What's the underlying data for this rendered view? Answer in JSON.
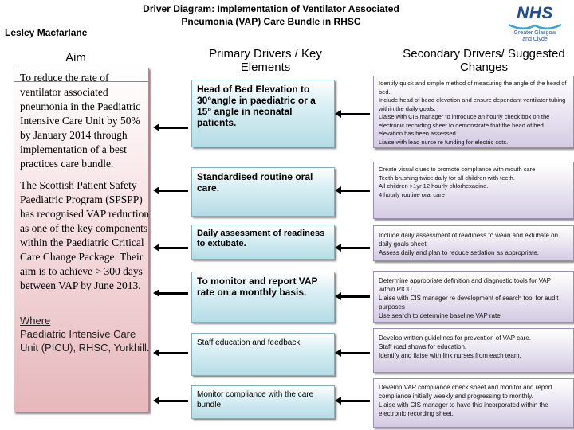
{
  "header": {
    "title_line1": "Driver Diagram: Implementation of Ventilator Associated",
    "title_line2": "Pneumonia (VAP) Care Bundle in RHSC",
    "author": "Lesley Macfarlane"
  },
  "logo": {
    "name": "NHS",
    "sub_line1": "Greater Glasgow",
    "sub_line2": "and Clyde",
    "brand_color": "#1f4e96"
  },
  "columns": {
    "aim": "Aim",
    "primary": "Primary Drivers / Key Elements",
    "secondary": "Secondary Drivers/ Suggested Changes"
  },
  "aim": {
    "text1": "To reduce the rate of ventilator associated pneumonia in the Paediatric Intensive Care Unit by 50% by January 2014 through implementation of a best practices care bundle.",
    "text2": "The Scottish Patient Safety Paediatric Program (SPSPP) has recognised VAP reduction as one of the key components within the Paediatric Critical Care Change Package. Their aim is to achieve > 300 days between VAP by June 2013.",
    "where_label": "Where",
    "where_text": "Paediatric Intensive Care Unit (PICU), RHSC, Yorkhill."
  },
  "primary_drivers": [
    {
      "text": "Head of Bed Elevation to 30°angle in paediatric or a 15° angle in neonatal patients."
    },
    {
      "text": "Standardised routine oral care."
    },
    {
      "text": "Daily assessment of readiness to extubate."
    },
    {
      "text": "To monitor and report VAP rate on a monthly basis."
    },
    {
      "text": "Staff education and feedback"
    },
    {
      "text": "Monitor compliance with the care bundle."
    }
  ],
  "secondary_drivers": [
    {
      "lines": [
        "Identify quick and simple method of measuring the angle of the head of bed.",
        "Include head of bead elevation and ensure dependant ventilator tubing within the daily goals.",
        "Liaise with CIS manager to introduce an hourly check box on the electronic recording sheet to demonstrate that the head of bed elevation has been assessed.",
        "Liaise with lead nurse re funding for electric cots."
      ]
    },
    {
      "lines": [
        "Create visual clues to promote compliance with mouth care",
        "Teeth brushing twice daily for all children with teeth.",
        "All children >1yr 12 hourly chlorhexadine.",
        "4 hourly routine oral care"
      ]
    },
    {
      "lines": [
        "Include daily assessment of readiness to wean and extubate on daily goals sheet.",
        "Assess daily and plan to reduce sedation as appropriate."
      ]
    },
    {
      "lines": [
        "Determine appropriate definition and diagnostic tools for VAP within PICU.",
        "Liaise with CIS manager re development of search tool for audit purposes",
        "Use search to determine baseline VAP rate."
      ]
    },
    {
      "lines": [
        "Develop written guidelines for prevention of VAP care.",
        "Staff road shows for education.",
        "Identify and liaise with link nurses from each team."
      ]
    },
    {
      "lines": [
        "Develop VAP compliance check sheet and monitor and report compliance initially weekly and progressing to monthly.",
        "Liaise with CIS manager to have this incorporated within the electronic recording sheet."
      ]
    }
  ]
}
